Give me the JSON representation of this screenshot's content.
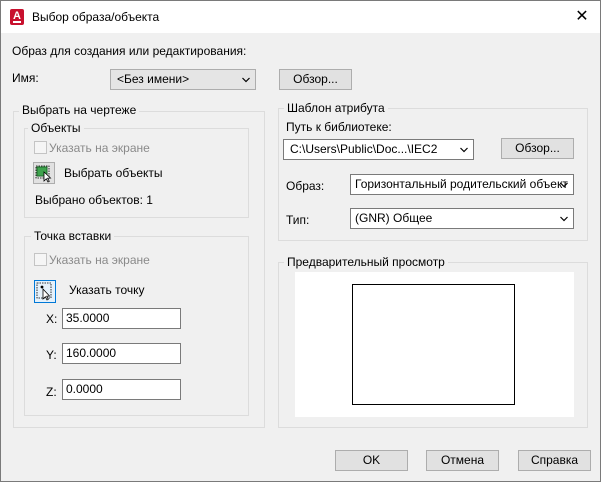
{
  "window": {
    "title": "Выбор образа/объекта",
    "app_icon_letter": "A",
    "close_glyph": "✕"
  },
  "top": {
    "prompt": "Образ для создания или редактирования:",
    "name_label": "Имя:",
    "name_value": "<Без имени>",
    "browse_label": "Обзор..."
  },
  "select_group": {
    "title": "Выбрать на чертеже",
    "objects": {
      "title": "Объекты",
      "specify_on_screen": "Указать на экране",
      "select_objects": "Выбрать объекты",
      "selected_count_text": "Выбрано объектов: 1"
    },
    "insertion_point": {
      "title": "Точка вставки",
      "specify_on_screen": "Указать на экране",
      "pick_point": "Указать точку",
      "x_label": "X:",
      "x_value": "35.0000",
      "y_label": "Y:",
      "y_value": "160.0000",
      "z_label": "Z:",
      "z_value": "0.0000"
    }
  },
  "attribute_template": {
    "title": "Шаблон атрибута",
    "library_path_label": "Путь к библиотеке:",
    "library_path_value": "C:\\Users\\Public\\Doc...\\IEC2",
    "browse_label": "Обзор...",
    "image_label": "Образ:",
    "image_value": "Горизонтальный родительский объект",
    "type_label": "Тип:",
    "type_value": "(GNR) Общее"
  },
  "preview": {
    "title": "Предварительный просмотр"
  },
  "footer": {
    "ok": "OK",
    "cancel": "Отмена",
    "help": "Справка"
  },
  "colors": {
    "app_icon": "#c8102e",
    "dialog_bg": "#f0f0f0",
    "disabled_text": "#8a8a8a"
  },
  "icons": {
    "app": "autocad-app-icon",
    "close": "close-icon",
    "select_objects": "select-objects-icon",
    "pick_point": "pick-point-icon",
    "dropdown": "chevron-down-icon"
  }
}
